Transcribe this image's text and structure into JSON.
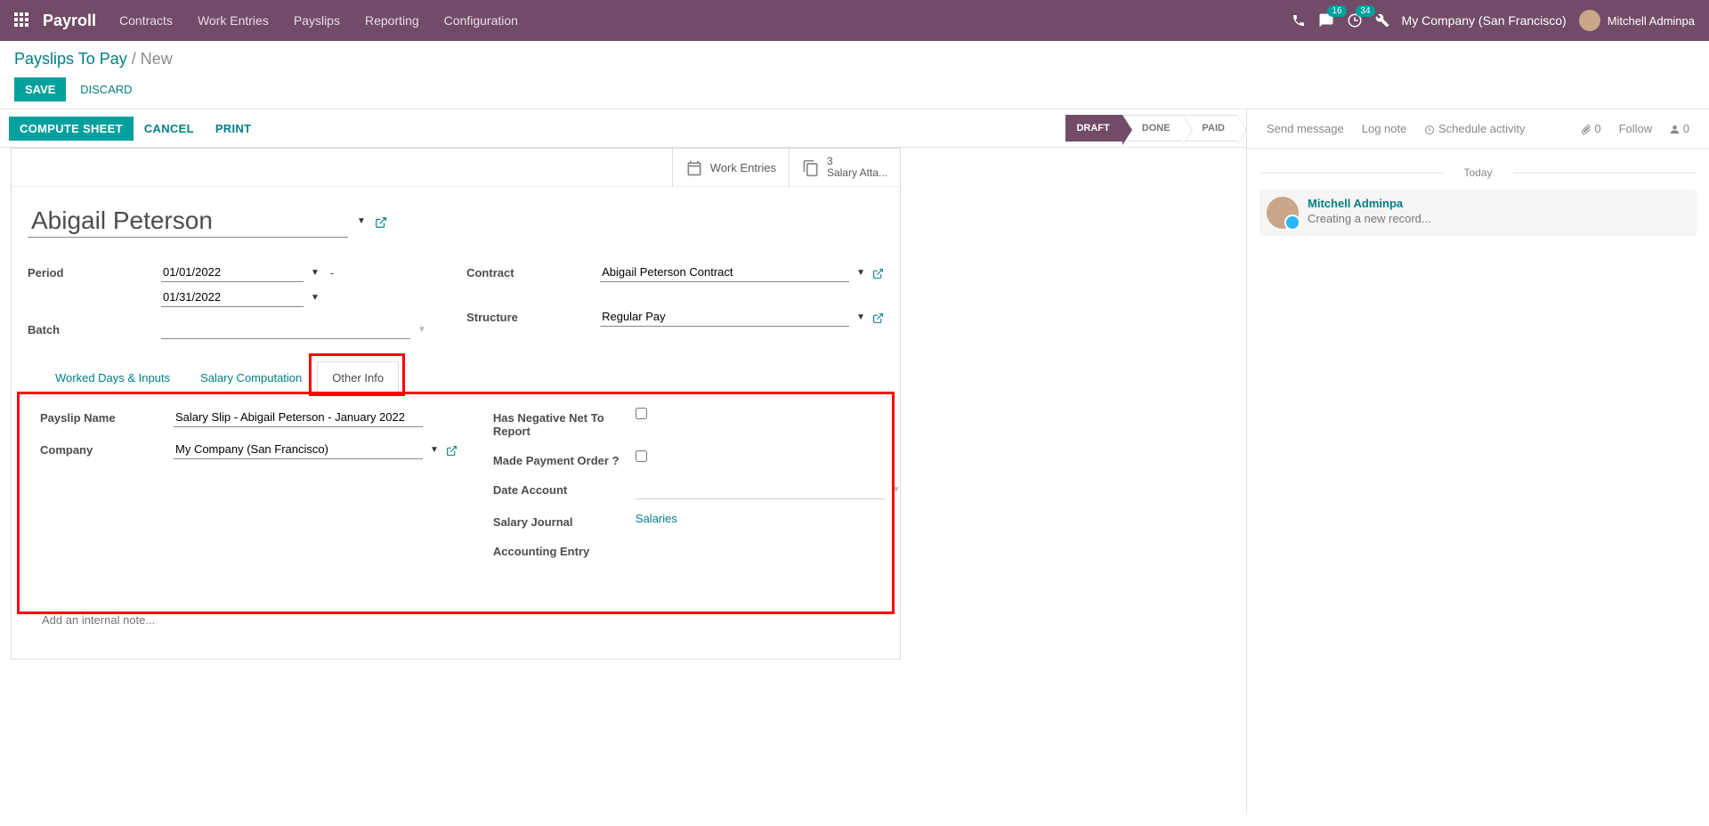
{
  "topnav": {
    "app": "Payroll",
    "links": [
      "Contracts",
      "Work Entries",
      "Payslips",
      "Reporting",
      "Configuration"
    ],
    "msg_badge": "16",
    "act_badge": "34",
    "company": "My Company (San Francisco)",
    "user": "Mitchell Adminpa"
  },
  "breadcrumb": {
    "parent": "Payslips To Pay",
    "current": "New"
  },
  "buttons": {
    "save": "SAVE",
    "discard": "DISCARD",
    "compute": "COMPUTE SHEET",
    "cancel": "CANCEL",
    "print": "PRINT"
  },
  "status": {
    "draft": "DRAFT",
    "done": "DONE",
    "paid": "PAID"
  },
  "stat": {
    "work_entries": "Work Entries",
    "salary_count": "3",
    "salary_label": "Salary Atta..."
  },
  "form": {
    "employee": "Abigail Peterson",
    "labels": {
      "period": "Period",
      "batch": "Batch",
      "contract": "Contract",
      "structure": "Structure"
    },
    "period_from": "01/01/2022",
    "period_to": "01/31/2022",
    "contract": "Abigail Peterson Contract",
    "structure": "Regular Pay"
  },
  "tabs": {
    "t1": "Worked Days & Inputs",
    "t2": "Salary Computation",
    "t3": "Other Info"
  },
  "other": {
    "labels": {
      "payslip_name": "Payslip Name",
      "company": "Company",
      "neg_net": "Has Negative Net To Report",
      "payment_order": "Made Payment Order ?",
      "date_account": "Date Account",
      "salary_journal": "Salary Journal",
      "acc_entry": "Accounting Entry"
    },
    "payslip_name": "Salary Slip - Abigail Peterson - January 2022",
    "company": "My Company (San Francisco)",
    "salary_journal": "Salaries",
    "note_placeholder": "Add an internal note..."
  },
  "chatter": {
    "send": "Send message",
    "log": "Log note",
    "schedule": "Schedule activity",
    "attach_count": "0",
    "follow": "Follow",
    "follower_count": "0",
    "today": "Today",
    "msg_author": "Mitchell Adminpa",
    "msg_text": "Creating a new record..."
  }
}
